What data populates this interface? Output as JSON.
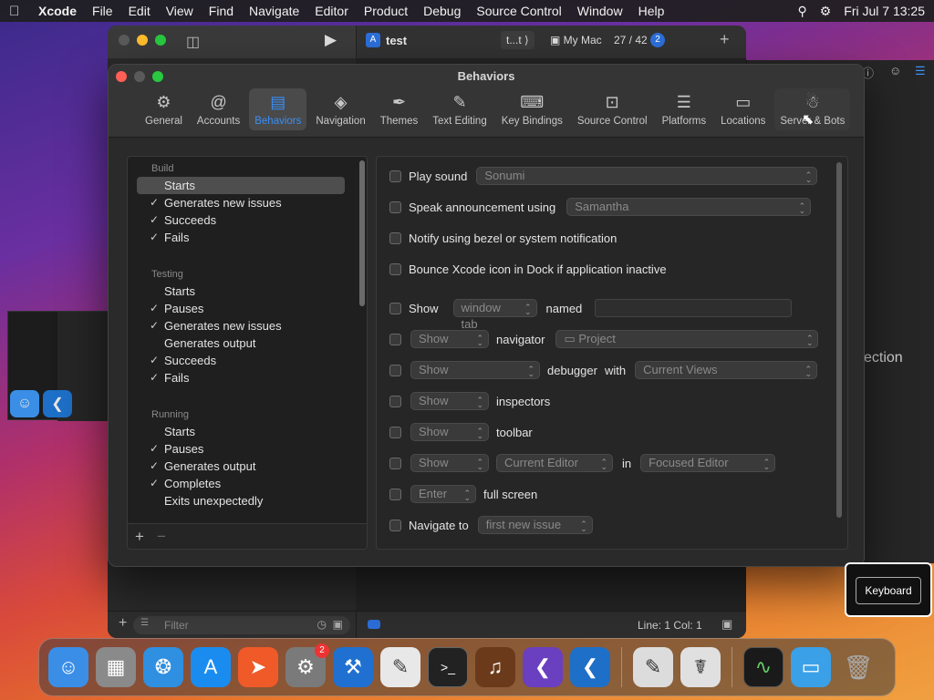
{
  "menubar": {
    "app": "Xcode",
    "items": [
      "File",
      "Edit",
      "View",
      "Find",
      "Navigate",
      "Editor",
      "Product",
      "Debug",
      "Source Control",
      "Window",
      "Help"
    ],
    "clock": "Fri Jul 7  13:25"
  },
  "xcode": {
    "project": "test",
    "scheme": "t...t",
    "destination": "My Mac",
    "counter": "27 / 42",
    "badge": "2",
    "filter_placeholder": "Filter",
    "cursor_pos": "Line: 1  Col: 1"
  },
  "side_window": {
    "partial_text": "ection"
  },
  "prefs": {
    "title": "Behaviors",
    "tabs": [
      {
        "label": "General",
        "icon": "gear-icon"
      },
      {
        "label": "Accounts",
        "icon": "at-icon"
      },
      {
        "label": "Behaviors",
        "icon": "behaviors-icon",
        "active": true
      },
      {
        "label": "Navigation",
        "icon": "navigation-icon"
      },
      {
        "label": "Themes",
        "icon": "brush-icon"
      },
      {
        "label": "Text Editing",
        "icon": "pencil-icon"
      },
      {
        "label": "Key Bindings",
        "icon": "keyboard-icon"
      },
      {
        "label": "Source Control",
        "icon": "source-control-icon"
      },
      {
        "label": "Platforms",
        "icon": "layers-icon"
      },
      {
        "label": "Locations",
        "icon": "drive-icon"
      },
      {
        "label": "Server & Bots",
        "icon": "robot-icon"
      }
    ],
    "categories": {
      "build": "Build",
      "build_items": [
        "Starts",
        "Generates new issues",
        "Succeeds",
        "Fails"
      ],
      "testing": "Testing",
      "testing_items": [
        "Starts",
        "Pauses",
        "Generates new issues",
        "Generates output",
        "Succeeds",
        "Fails"
      ],
      "running": "Running",
      "running_items": [
        "Starts",
        "Pauses",
        "Generates output",
        "Completes",
        "Exits unexpectedly"
      ]
    },
    "options": {
      "play_sound": "Play sound",
      "sound_value": "Sonumi",
      "speak": "Speak announcement using",
      "voice_value": "Samantha",
      "notify": "Notify using bezel or system notification",
      "bounce": "Bounce Xcode icon in Dock if application inactive",
      "show": "Show",
      "window_tab": "window tab",
      "named": "named",
      "show_value": "Show",
      "navigator": "navigator",
      "project": "Project",
      "debugger": "debugger",
      "with": "with",
      "current_views": "Current Views",
      "inspectors": "inspectors",
      "toolbar": "toolbar",
      "current_editor": "Current Editor",
      "in": "in",
      "focused_editor": "Focused Editor",
      "enter": "Enter",
      "full_screen": "full screen",
      "navigate_to": "Navigate to",
      "first_new_issue": "first new issue"
    }
  },
  "keyboard_hud": {
    "label": "Keyboard"
  },
  "dock": {
    "settings_badge": "2"
  }
}
